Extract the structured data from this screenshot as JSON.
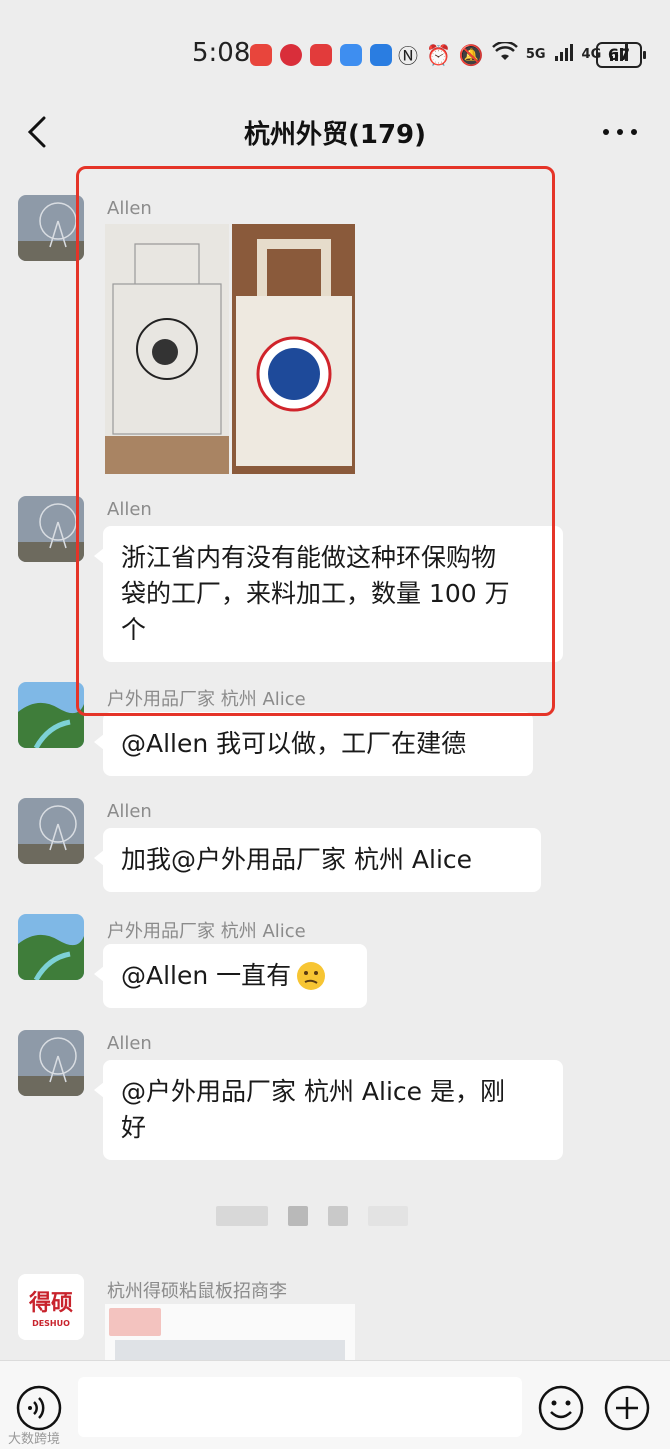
{
  "status": {
    "time": "5:08",
    "signal1": "5G",
    "signal2": "4G",
    "battery": "67"
  },
  "header": {
    "title": "杭州外贸(179)"
  },
  "messages": [
    {
      "sender": "Allen",
      "type": "image"
    },
    {
      "sender": "Allen",
      "text_line1": "浙江省内有没有能做这种环保购物",
      "text_line2": "袋的工厂，来料加工，数量 100 万",
      "text_line3": "个"
    },
    {
      "sender": "户外用品厂家 杭州 Alice",
      "text": "@Allen  我可以做，工厂在建德"
    },
    {
      "sender": "Allen",
      "text": "加我@户外用品厂家 杭州 Alice"
    },
    {
      "sender": "户外用品厂家 杭州 Alice",
      "text": "@Allen  一直有"
    },
    {
      "sender": "Allen",
      "text_line1": "@户外用品厂家 杭州 Alice 是，刚",
      "text_line2": "好"
    },
    {
      "sender": "杭州得硕粘鼠板招商李",
      "type": "image",
      "logo_text": "得硕",
      "logo_sub": "DESHUO"
    }
  ],
  "watermark": "大数跨境",
  "colors": {
    "highlight": "#e53428",
    "background": "#ededed"
  }
}
